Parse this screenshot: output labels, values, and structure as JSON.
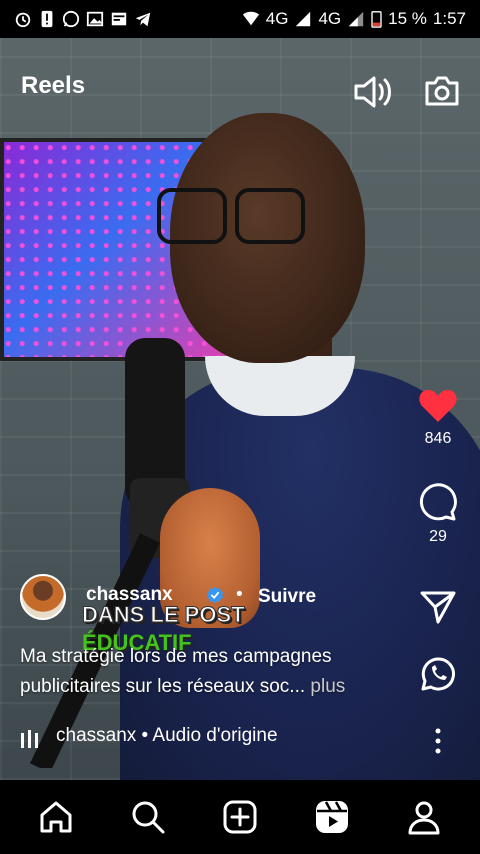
{
  "status_bar": {
    "network_1": "4G",
    "network_2": "4G",
    "battery": "15 %",
    "time": "1:57"
  },
  "header": {
    "title": "Reels",
    "sound_icon": "speaker-icon",
    "camera_icon": "camera-icon"
  },
  "overlay_text": {
    "line1": "DANS LE POST",
    "line2": "ÉDUCATIF"
  },
  "actions": {
    "like_count": "846",
    "comment_count": "29",
    "like_color": "#ff3040"
  },
  "post": {
    "username": "chassanx",
    "separator": "•",
    "follow_label": "Suivre",
    "caption": "Ma stratégie lors de mes campagnes publicitaires sur les réseaux soc...",
    "more_label": "plus",
    "audio": "chassanx • Audio d'origine"
  },
  "bottom_nav": {
    "items": [
      "home-icon",
      "search-icon",
      "create-icon",
      "reels-icon",
      "profile-icon"
    ]
  }
}
